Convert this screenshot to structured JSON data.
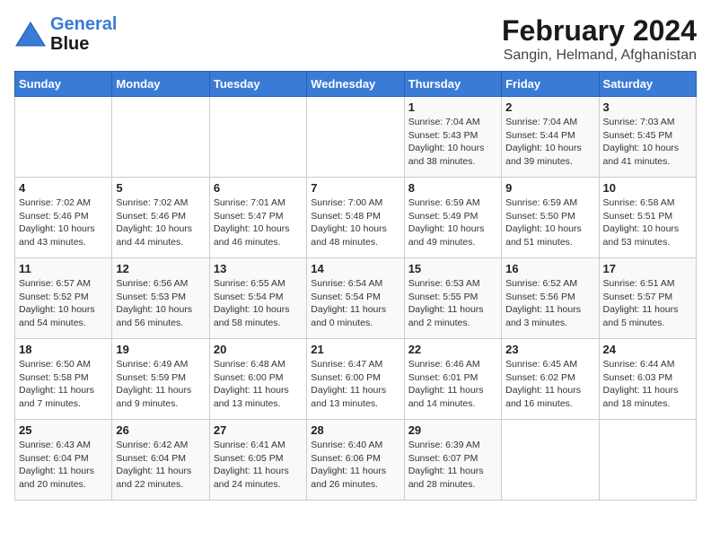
{
  "header": {
    "logo_line1": "General",
    "logo_line2": "Blue",
    "title": "February 2024",
    "subtitle": "Sangin, Helmand, Afghanistan"
  },
  "days_of_week": [
    "Sunday",
    "Monday",
    "Tuesday",
    "Wednesday",
    "Thursday",
    "Friday",
    "Saturday"
  ],
  "weeks": [
    [
      {
        "day": "",
        "info": ""
      },
      {
        "day": "",
        "info": ""
      },
      {
        "day": "",
        "info": ""
      },
      {
        "day": "",
        "info": ""
      },
      {
        "day": "1",
        "info": "Sunrise: 7:04 AM\nSunset: 5:43 PM\nDaylight: 10 hours\nand 38 minutes."
      },
      {
        "day": "2",
        "info": "Sunrise: 7:04 AM\nSunset: 5:44 PM\nDaylight: 10 hours\nand 39 minutes."
      },
      {
        "day": "3",
        "info": "Sunrise: 7:03 AM\nSunset: 5:45 PM\nDaylight: 10 hours\nand 41 minutes."
      }
    ],
    [
      {
        "day": "4",
        "info": "Sunrise: 7:02 AM\nSunset: 5:46 PM\nDaylight: 10 hours\nand 43 minutes."
      },
      {
        "day": "5",
        "info": "Sunrise: 7:02 AM\nSunset: 5:46 PM\nDaylight: 10 hours\nand 44 minutes."
      },
      {
        "day": "6",
        "info": "Sunrise: 7:01 AM\nSunset: 5:47 PM\nDaylight: 10 hours\nand 46 minutes."
      },
      {
        "day": "7",
        "info": "Sunrise: 7:00 AM\nSunset: 5:48 PM\nDaylight: 10 hours\nand 48 minutes."
      },
      {
        "day": "8",
        "info": "Sunrise: 6:59 AM\nSunset: 5:49 PM\nDaylight: 10 hours\nand 49 minutes."
      },
      {
        "day": "9",
        "info": "Sunrise: 6:59 AM\nSunset: 5:50 PM\nDaylight: 10 hours\nand 51 minutes."
      },
      {
        "day": "10",
        "info": "Sunrise: 6:58 AM\nSunset: 5:51 PM\nDaylight: 10 hours\nand 53 minutes."
      }
    ],
    [
      {
        "day": "11",
        "info": "Sunrise: 6:57 AM\nSunset: 5:52 PM\nDaylight: 10 hours\nand 54 minutes."
      },
      {
        "day": "12",
        "info": "Sunrise: 6:56 AM\nSunset: 5:53 PM\nDaylight: 10 hours\nand 56 minutes."
      },
      {
        "day": "13",
        "info": "Sunrise: 6:55 AM\nSunset: 5:54 PM\nDaylight: 10 hours\nand 58 minutes."
      },
      {
        "day": "14",
        "info": "Sunrise: 6:54 AM\nSunset: 5:54 PM\nDaylight: 11 hours\nand 0 minutes."
      },
      {
        "day": "15",
        "info": "Sunrise: 6:53 AM\nSunset: 5:55 PM\nDaylight: 11 hours\nand 2 minutes."
      },
      {
        "day": "16",
        "info": "Sunrise: 6:52 AM\nSunset: 5:56 PM\nDaylight: 11 hours\nand 3 minutes."
      },
      {
        "day": "17",
        "info": "Sunrise: 6:51 AM\nSunset: 5:57 PM\nDaylight: 11 hours\nand 5 minutes."
      }
    ],
    [
      {
        "day": "18",
        "info": "Sunrise: 6:50 AM\nSunset: 5:58 PM\nDaylight: 11 hours\nand 7 minutes."
      },
      {
        "day": "19",
        "info": "Sunrise: 6:49 AM\nSunset: 5:59 PM\nDaylight: 11 hours\nand 9 minutes."
      },
      {
        "day": "20",
        "info": "Sunrise: 6:48 AM\nSunset: 6:00 PM\nDaylight: 11 hours\nand 13 minutes."
      },
      {
        "day": "21",
        "info": "Sunrise: 6:47 AM\nSunset: 6:00 PM\nDaylight: 11 hours\nand 13 minutes."
      },
      {
        "day": "22",
        "info": "Sunrise: 6:46 AM\nSunset: 6:01 PM\nDaylight: 11 hours\nand 14 minutes."
      },
      {
        "day": "23",
        "info": "Sunrise: 6:45 AM\nSunset: 6:02 PM\nDaylight: 11 hours\nand 16 minutes."
      },
      {
        "day": "24",
        "info": "Sunrise: 6:44 AM\nSunset: 6:03 PM\nDaylight: 11 hours\nand 18 minutes."
      }
    ],
    [
      {
        "day": "25",
        "info": "Sunrise: 6:43 AM\nSunset: 6:04 PM\nDaylight: 11 hours\nand 20 minutes."
      },
      {
        "day": "26",
        "info": "Sunrise: 6:42 AM\nSunset: 6:04 PM\nDaylight: 11 hours\nand 22 minutes."
      },
      {
        "day": "27",
        "info": "Sunrise: 6:41 AM\nSunset: 6:05 PM\nDaylight: 11 hours\nand 24 minutes."
      },
      {
        "day": "28",
        "info": "Sunrise: 6:40 AM\nSunset: 6:06 PM\nDaylight: 11 hours\nand 26 minutes."
      },
      {
        "day": "29",
        "info": "Sunrise: 6:39 AM\nSunset: 6:07 PM\nDaylight: 11 hours\nand 28 minutes."
      },
      {
        "day": "",
        "info": ""
      },
      {
        "day": "",
        "info": ""
      }
    ]
  ]
}
